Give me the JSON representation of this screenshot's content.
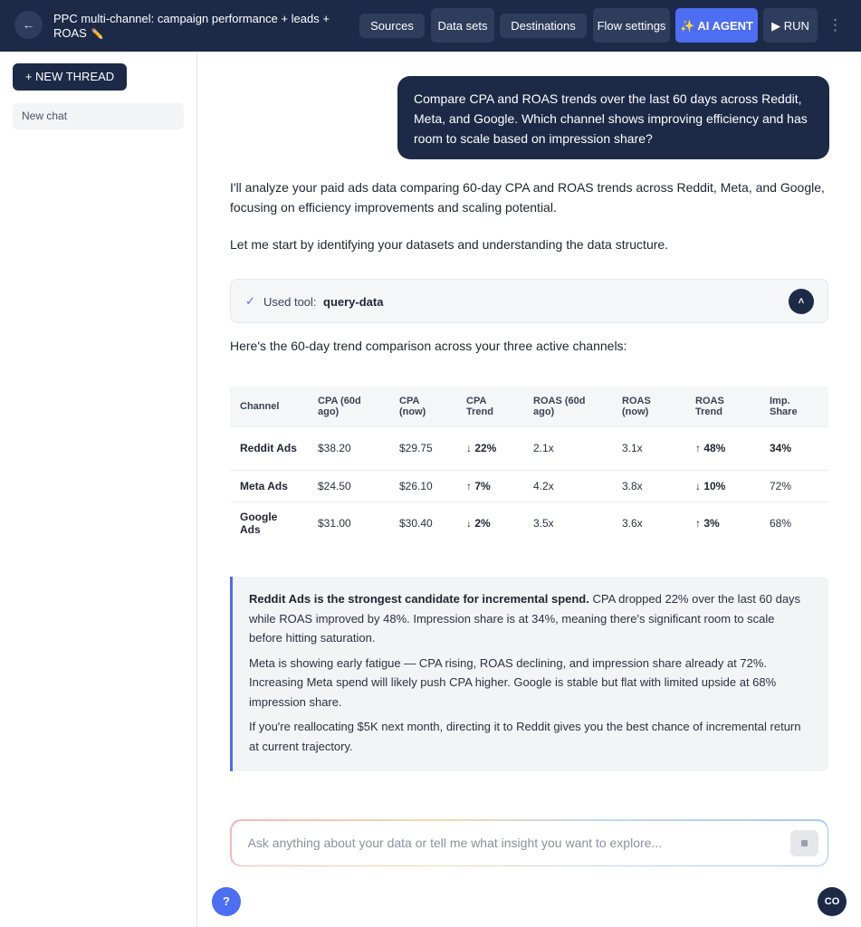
{
  "header": {
    "back_icon": "←",
    "title": "PPC multi-channel: campaign performance + leads + ROAS",
    "edit_icon": "✏️",
    "buttons": {
      "sources": "Sources",
      "datasets": "Data sets",
      "destinations": "Destinations",
      "flow_settings": "Flow settings",
      "ai_agent": "✨ AI AGENT",
      "run": "▶ RUN"
    },
    "more_icon": "⋮"
  },
  "sidebar": {
    "new_thread": "+ NEW THREAD",
    "threads": [
      {
        "label": "New chat"
      }
    ]
  },
  "chat": {
    "user_message": "Compare CPA and ROAS trends over the last 60 days across Reddit, Meta, and Google. Which channel shows improving efficiency and has room to scale based on impression share?",
    "intro": "I'll analyze your paid ads data comparing 60-day CPA and ROAS trends across Reddit, Meta, and Google, focusing on efficiency improvements and scaling potential.",
    "start": "Let me start by identifying your datasets and understanding the data structure.",
    "tool": {
      "check": "✓",
      "label": "Used tool:",
      "name": "query-data",
      "toggle": "˄"
    },
    "table_intro": "Here's the 60-day trend comparison across your three active channels:",
    "table": {
      "headers": [
        "Channel",
        "CPA (60d ago)",
        "CPA (now)",
        "CPA Trend",
        "ROAS (60d ago)",
        "ROAS (now)",
        "ROAS Trend",
        "Imp. Share"
      ],
      "rows": [
        [
          "Reddit Ads",
          "$38.20",
          "$29.75",
          "↓ 22%",
          "2.1x",
          "3.1x",
          "↑ 48%",
          "34%"
        ],
        [
          "Meta Ads",
          "$24.50",
          "$26.10",
          "↑ 7%",
          "4.2x",
          "3.8x",
          "↓ 10%",
          "72%"
        ],
        [
          "Google Ads",
          "$31.00",
          "$30.40",
          "↓ 2%",
          "3.5x",
          "3.6x",
          "↑ 3%",
          "68%"
        ]
      ]
    },
    "insight": {
      "p1_bold": "Reddit Ads is the strongest candidate for incremental spend.",
      "p1_rest": " CPA dropped 22% over the last 60 days while ROAS improved by 48%. Impression share is at 34%, meaning there's significant room to scale before hitting saturation.",
      "p2": "Meta is showing early fatigue — CPA rising, ROAS declining, and impression share already at 72%. Increasing Meta spend will likely push CPA higher. Google is stable but flat with limited upside at 68% impression share.",
      "p3": "If you're reallocating $5K next month, directing it to Reddit gives you the best chance of incremental return at current trajectory."
    }
  },
  "composer": {
    "placeholder": "Ask anything about your data or tell me what insight you want to explore...",
    "value": ""
  },
  "footer": {
    "help": "?",
    "avatar_initials": "CO"
  },
  "colors": {
    "navy": "#1c2a47",
    "accent": "#4d6df2"
  }
}
